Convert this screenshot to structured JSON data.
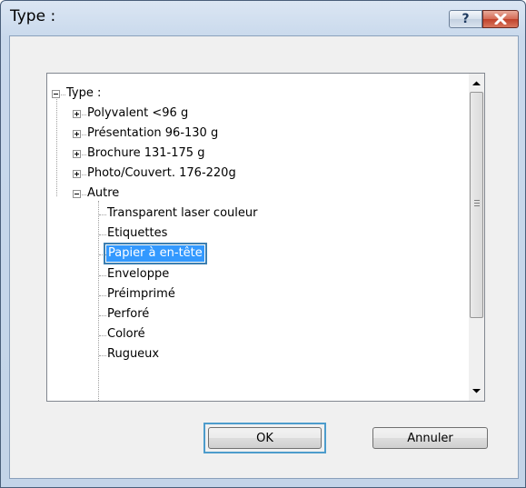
{
  "window": {
    "title": "Type :"
  },
  "tree": {
    "root": "Type :",
    "items": [
      {
        "label": "Polyvalent <96 g",
        "expander": "plus"
      },
      {
        "label": "Présentation 96-130 g",
        "expander": "plus"
      },
      {
        "label": "Brochure 131-175 g",
        "expander": "plus"
      },
      {
        "label": "Photo/Couvert. 176-220g",
        "expander": "plus"
      },
      {
        "label": "Autre",
        "expander": "minus"
      }
    ],
    "children": [
      "Transparent laser couleur",
      "Etiquettes",
      "Papier à en-tête",
      "Enveloppe",
      "Préimprimé",
      "Perforé",
      "Coloré",
      "Rugueux"
    ],
    "selected": "Papier à en-tête"
  },
  "buttons": {
    "ok": "OK",
    "cancel": "Annuler"
  },
  "icons": {
    "help": "?",
    "close": "close-icon"
  },
  "colors": {
    "selection": "#3399ff",
    "focus": "#4d9ccc"
  }
}
